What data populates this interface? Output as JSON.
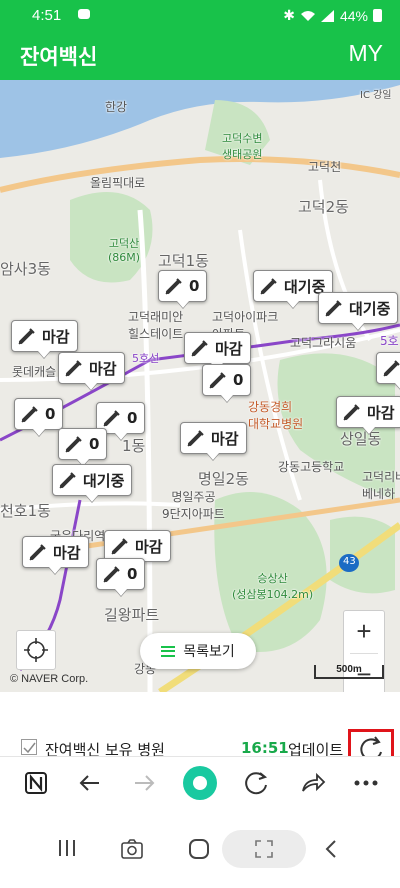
{
  "status_bar": {
    "time": "4:51",
    "battery": "44%"
  },
  "header": {
    "title": "잔여백신",
    "my_label": "MY"
  },
  "map": {
    "labels": {
      "hangang": "한강",
      "olympic_road": "올림픽대로",
      "godeok_susaeng": "고덕수변\n생태공원",
      "godeokcheon": "고덕천",
      "godeok2dong": "고덕2동",
      "godeoksan": "고덕산\n(86M)",
      "amsa3dong": "암사3동",
      "godeok1dong": "고덕1동",
      "godeok_raemian": "고덕래미안\n힐스테이트",
      "godeok_ipark": "고덕아이파크\n아파트",
      "godeok_grasium": "고덕그라시움",
      "lotte_castle": "롯데캐슬",
      "kyunghee_hospital": "강동경희\n대학교병원",
      "sangil_dong": "상일동",
      "gangdong_highschool": "강동고등학교",
      "godeok_riverside": "고덕리버\n베네하",
      "myeongil2dong": "명일2동",
      "myeongil_jugong": "명일주공\n9단지아파트",
      "myeongil1dong": "1동",
      "cheonho1dong": "천호1동",
      "gudeok_dairyeon": "굽은다리역",
      "seungsangsan": "승상산\n(성삼봉104.2m)",
      "gilwang_apt": "길왕파트",
      "gangdong_office": "강동",
      "route_43": "43",
      "line5_east": "5호",
      "line5_west": "5호선",
      "ic": "IC 강일"
    },
    "markers": [
      {
        "text": "0",
        "kind": "count"
      },
      {
        "text": "대기중",
        "kind": "waiting"
      },
      {
        "text": "대기중",
        "kind": "waiting"
      },
      {
        "text": "마감",
        "kind": "closed"
      },
      {
        "text": "마감",
        "kind": "closed"
      },
      {
        "text": "0",
        "kind": "count"
      },
      {
        "text": "마감",
        "kind": "closed"
      },
      {
        "text": "0",
        "kind": "count"
      },
      {
        "text": "마감",
        "kind": "closed"
      },
      {
        "text": "0",
        "kind": "count"
      },
      {
        "text": "0",
        "kind": "count"
      },
      {
        "text": "마감",
        "kind": "closed"
      },
      {
        "text": "0",
        "kind": "count"
      },
      {
        "text": "대기중",
        "kind": "waiting"
      },
      {
        "text": "마감",
        "kind": "closed"
      },
      {
        "text": "마감",
        "kind": "closed"
      },
      {
        "text": "0",
        "kind": "count"
      }
    ],
    "list_button": "목록보기",
    "copyright": "© NAVER Corp.",
    "scale": "500m",
    "zoom_in": "+",
    "zoom_out": "−"
  },
  "bottom": {
    "checkbox_label": "잔여백신 보유 병원",
    "update_time": "16:51",
    "update_label": "업데이트"
  },
  "colors": {
    "brand": "#18c24a",
    "highlight": "#e0141a"
  }
}
